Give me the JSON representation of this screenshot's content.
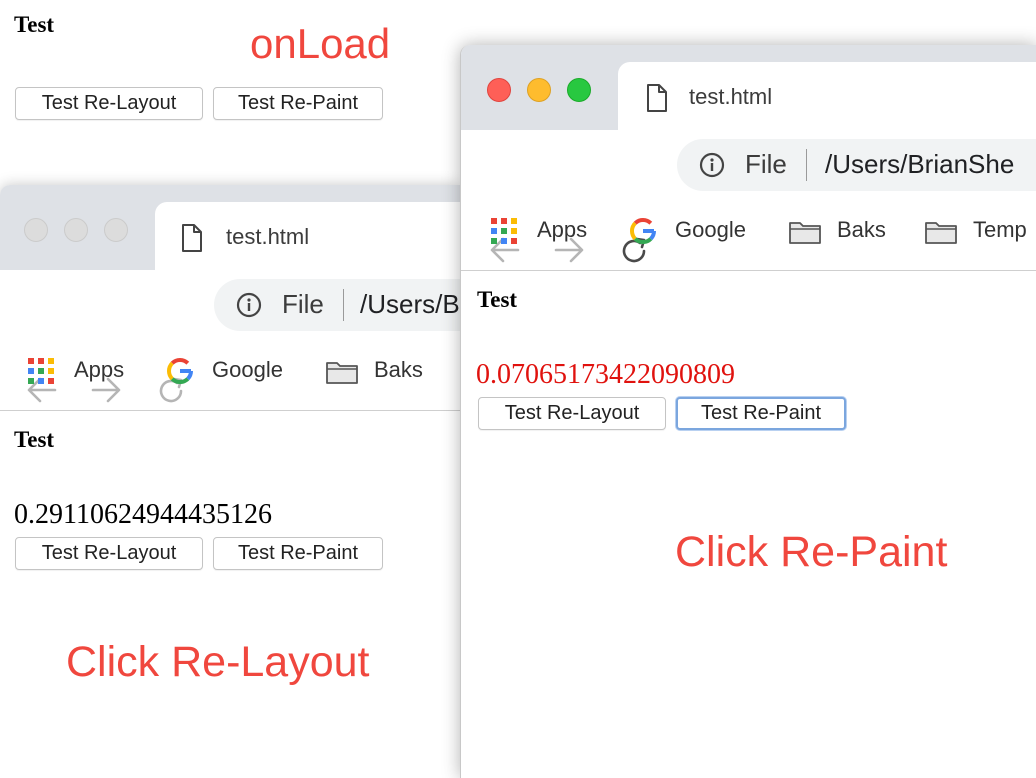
{
  "top_page": {
    "heading": "Test",
    "annotation": "onLoad",
    "buttons": {
      "relayout": "Test Re-Layout",
      "repaint": "Test Re-Paint"
    }
  },
  "window_relayout": {
    "tab_title": "test.html",
    "address": {
      "scheme": "File",
      "path": "/Users/B"
    },
    "bookmarks": [
      "Apps",
      "Google",
      "Baks"
    ],
    "page": {
      "heading": "Test",
      "value": "0.29110624944435126",
      "buttons": {
        "relayout": "Test Re-Layout",
        "repaint": "Test Re-Paint"
      }
    },
    "annotation": "Click Re-Layout",
    "traffic_lights": "inactive"
  },
  "window_repaint": {
    "tab_title": "test.html",
    "address": {
      "scheme": "File",
      "path": "/Users/BrianShe"
    },
    "bookmarks": [
      "Apps",
      "Google",
      "Baks",
      "Temp"
    ],
    "page": {
      "heading": "Test",
      "value": "0.07065173422090809",
      "buttons": {
        "relayout": "Test Re-Layout",
        "repaint": "Test Re-Paint"
      }
    },
    "annotation": "Click Re-Paint",
    "traffic_lights": "active"
  },
  "colors": {
    "annotation": "#f0473e",
    "value_red": "#e0120e",
    "focus_ring": "#7ba6de",
    "light_red": "#fe5f57",
    "light_yellow": "#febc2e",
    "light_green": "#28c840",
    "light_inactive": "#dcdcdc"
  },
  "icons": [
    "file-icon",
    "back-arrow-icon",
    "forward-arrow-icon",
    "reload-icon",
    "info-icon",
    "apps-grid-icon",
    "google-g-icon",
    "folder-icon"
  ]
}
